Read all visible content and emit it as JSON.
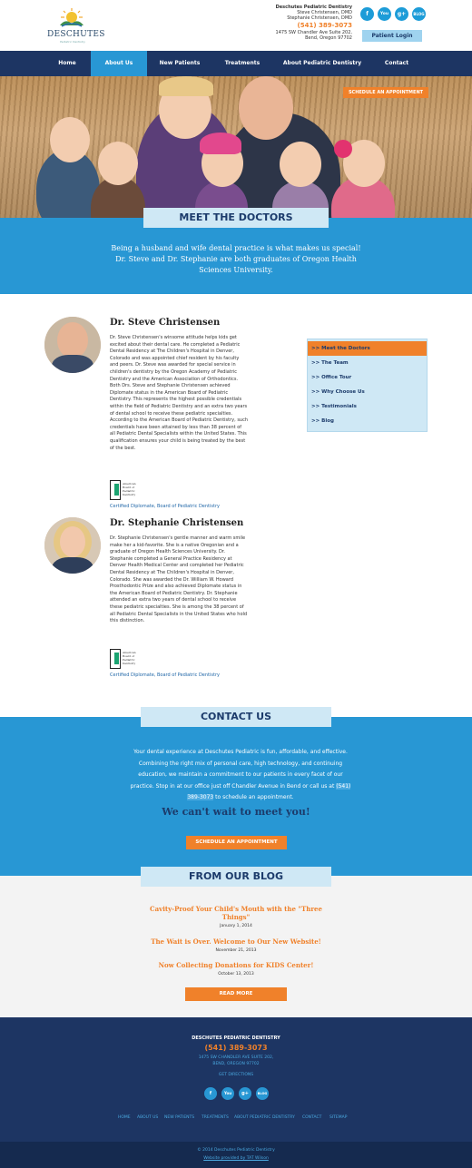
{
  "header": {
    "logo_text": "DESCHUTES",
    "logo_tagline": "Pediatric Dentistry",
    "practice_name": "Deschutes Pediatric Dentistry",
    "doctor_1": "Steve Christensen, DMD",
    "doctor_2": "Stephanie Christensen, DMD",
    "phone": "(541) 389-3073",
    "address_1": "1475 SW Chandler Ave Suite 202,",
    "address_2": "Bend, Oregon 97702",
    "patient_login": "Patient Login",
    "social": [
      "f",
      "You",
      "g+",
      "BLOG"
    ]
  },
  "nav": {
    "items": [
      "Home",
      "About Us",
      "New Patients",
      "Treatments",
      "About Pediatric Dentistry",
      "Contact"
    ],
    "active": "About Us"
  },
  "hero": {
    "schedule_label": "SCHEDULE AN APPOINTMENT"
  },
  "meet": {
    "heading": "MEET THE DOCTORS",
    "text": "Being a husband and wife dental practice is what makes us special! Dr. Steve and Dr. Stephanie are both graduates of Oregon Health Sciences University."
  },
  "doctors": [
    {
      "name": "Dr. Steve Christensen",
      "bio": "Dr. Steve Christensen's winsome attitude helps kids get excited about their dental care. He completed a Pediatric Dental Residency at The Children's Hospital in Denver, Colorado and was appointed chief resident by his faculty and peers. Dr. Steve was awarded for special service in children's dentistry by the Oregon Academy of Pediatric Dentistry and the American Association of Orthodontics. Both Drs. Steve and Stephanie Christensen achieved Diplomate status in the American Board of Pediatric Dentistry. This represents the highest possible credentials within the field of Pediatric Dentistry and an extra two years of dental school to receive these pediatric specialties. According to the American Board of Pediatric Dentistry, such credentials have been attained by less than 38 percent of all Pediatric Dental Specialists within the United States. This qualification ensures your child is being treated by the best of the best.",
      "badge_text": "American Board of Pediatric Dentistry",
      "caption": "Certified Diplomate, Board of Pediatric Dentistry"
    },
    {
      "name": "Dr. Stephanie Christensen",
      "bio": "Dr. Stephanie Christensen's gentle manner and warm smile make her a kid-favorite. She is a native Oregonian and a graduate of Oregon Health Sciences University. Dr. Stephanie completed a General Practice Residency at Denver Health Medical Center and completed her Pediatric Dental Residency at The Children's Hospital in Denver, Colorado. She was awarded the Dr. William W. Howard Prosthodontic Prize and also achieved Diplomate status in the American Board of Pediatric Dentistry. Dr. Stephanie attended an extra two years of dental school to receive these pediatric specialties. She is among the 38 percent of all Pediatric Dental Specialists in the United States who hold this distinction.",
      "badge_text": "American Board of Pediatric Dentistry",
      "caption": "Certified Diplomate, Board of Pediatric Dentistry"
    }
  ],
  "sidebar": {
    "items": [
      ">> Meet the Doctors",
      ">> The Team",
      ">> Office Tour",
      ">> Why Choose Us",
      ">> Testimonials",
      ">> Blog"
    ],
    "active": ">> Meet the Doctors"
  },
  "contact": {
    "heading": "CONTACT US",
    "text_1": "Your dental experience at Deschutes Pediatric is fun, affordable, and effective. Combining the right mix of personal care, high technology, and continuing education, we maintain a commitment to our patients in every facet of our practice. Stop in at our office just off Chandler Avenue in Bend or call us at",
    "phone": "(541) 389-3073",
    "text_2": "to schedule an appointment.",
    "tagline": "We can't wait to meet you!",
    "button": "SCHEDULE AN APPOINTMENT"
  },
  "blog": {
    "heading": "FROM OUR BLOG",
    "posts": [
      {
        "title": "Cavity-Proof Your Child's Mouth with the \"Three Things\"",
        "date": "January 1, 2014"
      },
      {
        "title": "The Wait is Over. Welcome to Our New Website!",
        "date": "November 21, 2013"
      },
      {
        "title": "Now Collecting Donations for KIDS Center!",
        "date": "October 13, 2013"
      }
    ],
    "button": "READ MORE"
  },
  "footer": {
    "title": "DESCHUTES PEDIATRIC DENTISTRY",
    "phone": "(541) 389-3073",
    "address_1": "1475 SW CHANDLER AVE SUITE 202,",
    "address_2": "BEND, OREGON 97702",
    "directions": "GET DIRECTIONS",
    "social": [
      "f",
      "You",
      "g+",
      "BLOG"
    ],
    "links": [
      "HOME",
      "ABOUT US",
      "NEW PATIENTS",
      "TREATMENTS",
      "ABOUT PEDIATRIC DENTISTRY",
      "CONTACT",
      "SITEMAP"
    ],
    "copyright": "© 2014 Deschutes Pediatric Dentistry",
    "credit": "Website provided by TAT Wilson"
  },
  "colors": {
    "navy": "#1d3563",
    "blue": "#2897d4",
    "orange": "#f0812a",
    "light_blue": "#cfe8f5"
  }
}
